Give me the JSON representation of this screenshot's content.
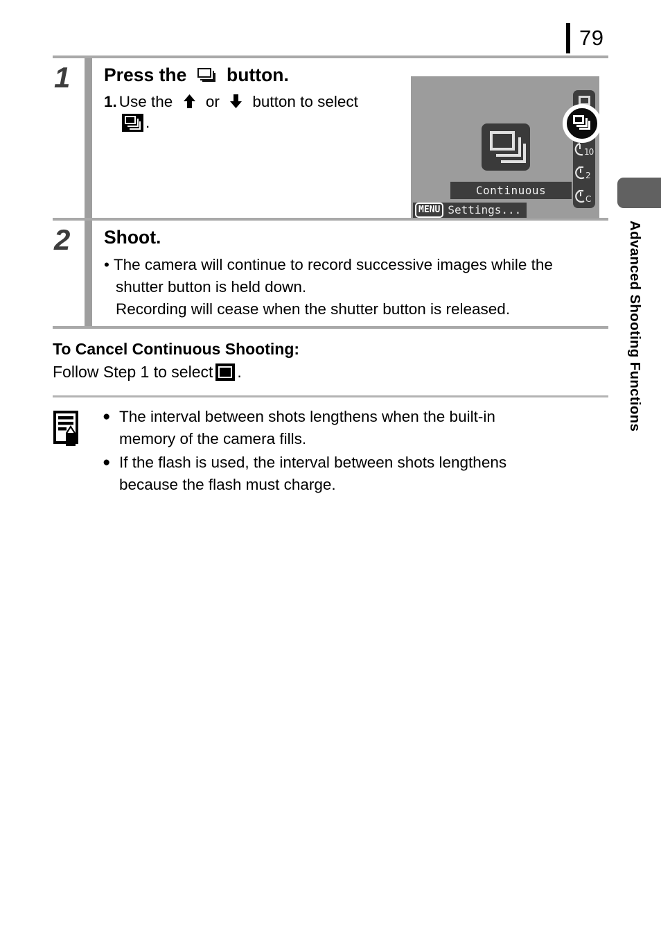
{
  "page": {
    "number": "79",
    "side_tab_label": "Advanced Shooting Functions"
  },
  "steps": [
    {
      "number": "1",
      "title_before": "Press the ",
      "title_icon": "continuous-shooting-icon",
      "title_after": " button.",
      "substeps": [
        {
          "number": "1.",
          "text_before": "Use the ",
          "icon_up": "arrow-up-icon",
          "text_mid": " or ",
          "icon_down": "arrow-down-icon",
          "text_after": " button to select",
          "line2_icon": "continuous-shooting-selected-icon",
          "line2_after": "."
        }
      ]
    },
    {
      "number": "2",
      "title": "Shoot.",
      "bullets": [
        {
          "dot": "•",
          "line1": "The camera will continue to record successive images while the",
          "line2": "shutter button is held down.",
          "line3": "Recording will cease when the shutter button is released."
        }
      ]
    }
  ],
  "cancel_section": {
    "heading": "To Cancel Continuous Shooting:",
    "text_before": "Follow Step 1 to select ",
    "icon": "single-shot-icon",
    "text_after": "."
  },
  "note_section": {
    "icon": "note-pencil-icon",
    "items": [
      {
        "bullet": "●",
        "line1": "The interval between shots lengthens when the built-in",
        "line2": "memory of the camera fills."
      },
      {
        "bullet": "●",
        "line1": "If the flash is used, the interval between shots lengthens",
        "line2": "because the flash must charge."
      }
    ]
  },
  "lcd": {
    "center_icon": "continuous-shooting-large-icon",
    "mode_label": "Continuous",
    "menu_badge": "MENU",
    "menu_text": "Settings...",
    "strip": [
      {
        "name": "single-shot-icon",
        "glyph": ""
      },
      {
        "name": "continuous-shooting-icon",
        "glyph": ""
      },
      {
        "name": "self-timer-10s-icon",
        "glyph": "◔",
        "label": "10"
      },
      {
        "name": "self-timer-2s-icon",
        "glyph": "◔",
        "label": "2"
      },
      {
        "name": "self-timer-custom-icon",
        "glyph": "◔",
        "label": "C"
      }
    ],
    "selected_index": 1
  },
  "colors": {
    "rule": "#a9a9a9",
    "step_bar": "#9e9e9e",
    "step_number": "#3d3d3d",
    "side_tab": "#616161",
    "lcd_background": "#9c9c9c",
    "lcd_panel": "#3d3d3d",
    "text": "#000000"
  }
}
